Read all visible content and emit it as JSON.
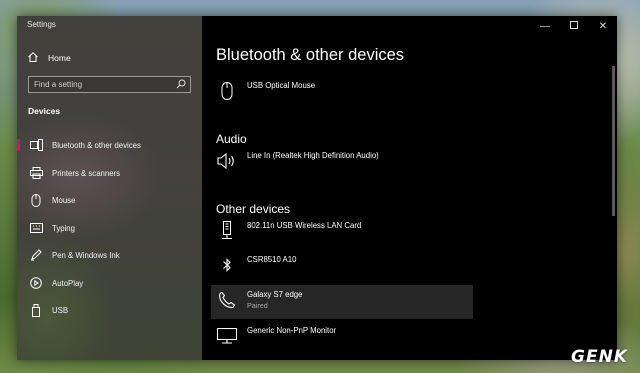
{
  "window": {
    "title": "Settings"
  },
  "sidebar": {
    "home_label": "Home",
    "search_placeholder": "Find a setting",
    "section_label": "Devices",
    "items": [
      {
        "label": "Bluetooth & other devices",
        "icon": "bluetooth-devices-icon",
        "active": true
      },
      {
        "label": "Printers & scanners",
        "icon": "printer-icon"
      },
      {
        "label": "Mouse",
        "icon": "mouse-icon"
      },
      {
        "label": "Typing",
        "icon": "keyboard-icon"
      },
      {
        "label": "Pen & Windows Ink",
        "icon": "pen-icon"
      },
      {
        "label": "AutoPlay",
        "icon": "autoplay-icon"
      },
      {
        "label": "USB",
        "icon": "usb-icon"
      }
    ],
    "accent_color": "#e3008c"
  },
  "main": {
    "page_title": "Bluetooth & other devices",
    "top_device": {
      "name": "USB Optical Mouse",
      "icon": "mouse-icon"
    },
    "audio": {
      "heading": "Audio",
      "devices": [
        {
          "name": "Line In (Realtek High Definition Audio)",
          "icon": "speaker-icon"
        }
      ]
    },
    "other": {
      "heading": "Other devices",
      "devices": [
        {
          "name": "802.11n USB Wireless LAN Card",
          "icon": "network-adapter-icon"
        },
        {
          "name": "CSR8510 A10",
          "icon": "bluetooth-icon"
        },
        {
          "name": "Galaxy S7 edge",
          "status": "Paired",
          "icon": "phone-icon",
          "selected": true
        },
        {
          "name": "Generic Non-PnP Monitor",
          "icon": "monitor-icon"
        }
      ]
    }
  },
  "watermark": {
    "text": "GENK"
  }
}
